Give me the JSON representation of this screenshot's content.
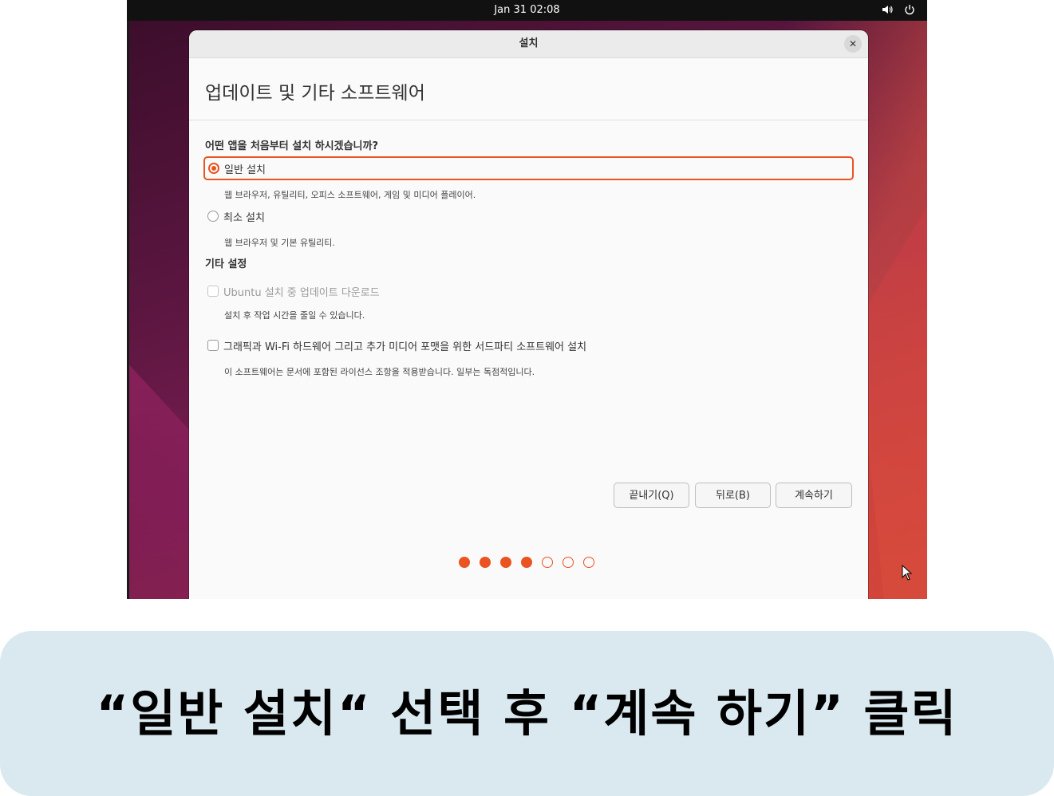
{
  "topbar": {
    "clock": "Jan 31  02:08",
    "tray_icons": [
      "speaker-icon",
      "power-icon"
    ]
  },
  "dialog": {
    "title": "설치",
    "close_label": "✕",
    "heading": "업데이트 및 기타 소프트웨어",
    "question": "어떤 앱을 처음부터 설치 하시겠습니까?",
    "options": [
      {
        "label": "일반 설치",
        "description": "웹 브라우저, 유틸리티, 오피스  소프트웨어, 게임 및 미디어 플레이어.",
        "selected": true
      },
      {
        "label": "최소 설치",
        "description": "웹 브라우저 및 기본 유틸리티.",
        "selected": false
      }
    ],
    "other_settings": {
      "title": "기타 설정",
      "items": [
        {
          "label": "Ubuntu 설치 중 업데이트 다운로드",
          "description": "설치 후 작업 시간을 줄일 수 있습니다.",
          "checked": false,
          "disabled": true
        },
        {
          "label": "그래픽과 Wi-Fi 하드웨어 그리고 추가 미디어 포맷을 위한 서드파티 소프트웨어 설치",
          "description": "이 소프트웨어는 문서에 포함된 라이선스 조항을 적용받습니다. 일부는 독점적입니다.",
          "checked": false,
          "disabled": false
        }
      ]
    },
    "buttons": {
      "quit": "끝내기(Q)",
      "back": "뒤로(B)",
      "continue": "계속하기"
    },
    "progress": {
      "total_steps": 7,
      "completed_steps": 4
    }
  },
  "caption": "“일반 설치“ 선택 후 “계속 하기” 클릭",
  "colors": {
    "accent": "#e95420",
    "caption_bg": "#d9e9ef"
  }
}
